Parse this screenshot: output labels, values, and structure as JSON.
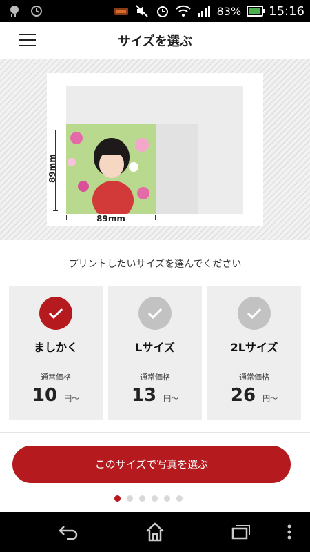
{
  "status_bar": {
    "signal_percent": "83%",
    "time": "15:16"
  },
  "header": {
    "title": "サイズを選ぶ"
  },
  "preview": {
    "width_label": "89mm",
    "height_label": "89mm"
  },
  "prompt": "プリントしたいサイズを選んでください",
  "options": [
    {
      "name": "ましかく",
      "price_label": "通常価格",
      "price": "10",
      "unit": "円〜",
      "selected": true
    },
    {
      "name": "Lサイズ",
      "price_label": "通常価格",
      "price": "13",
      "unit": "円〜",
      "selected": false
    },
    {
      "name": "2Lサイズ",
      "price_label": "通常価格",
      "price": "26",
      "unit": "円〜",
      "selected": false
    }
  ],
  "cta": {
    "label": "このサイズで写真を選ぶ"
  },
  "pager": {
    "count": 6,
    "active": 0
  },
  "colors": {
    "accent": "#b51b1e",
    "card_bg": "#eeeeee",
    "check_gray": "#c2c2c2"
  },
  "icons": [
    "weather-icon",
    "sync-icon",
    "notification-icon",
    "mute-icon",
    "alarm-icon",
    "wifi-icon",
    "signal-icon",
    "battery-icon",
    "menu-icon",
    "check-icon",
    "back-icon",
    "home-icon",
    "recent-apps-icon",
    "overflow-icon"
  ]
}
